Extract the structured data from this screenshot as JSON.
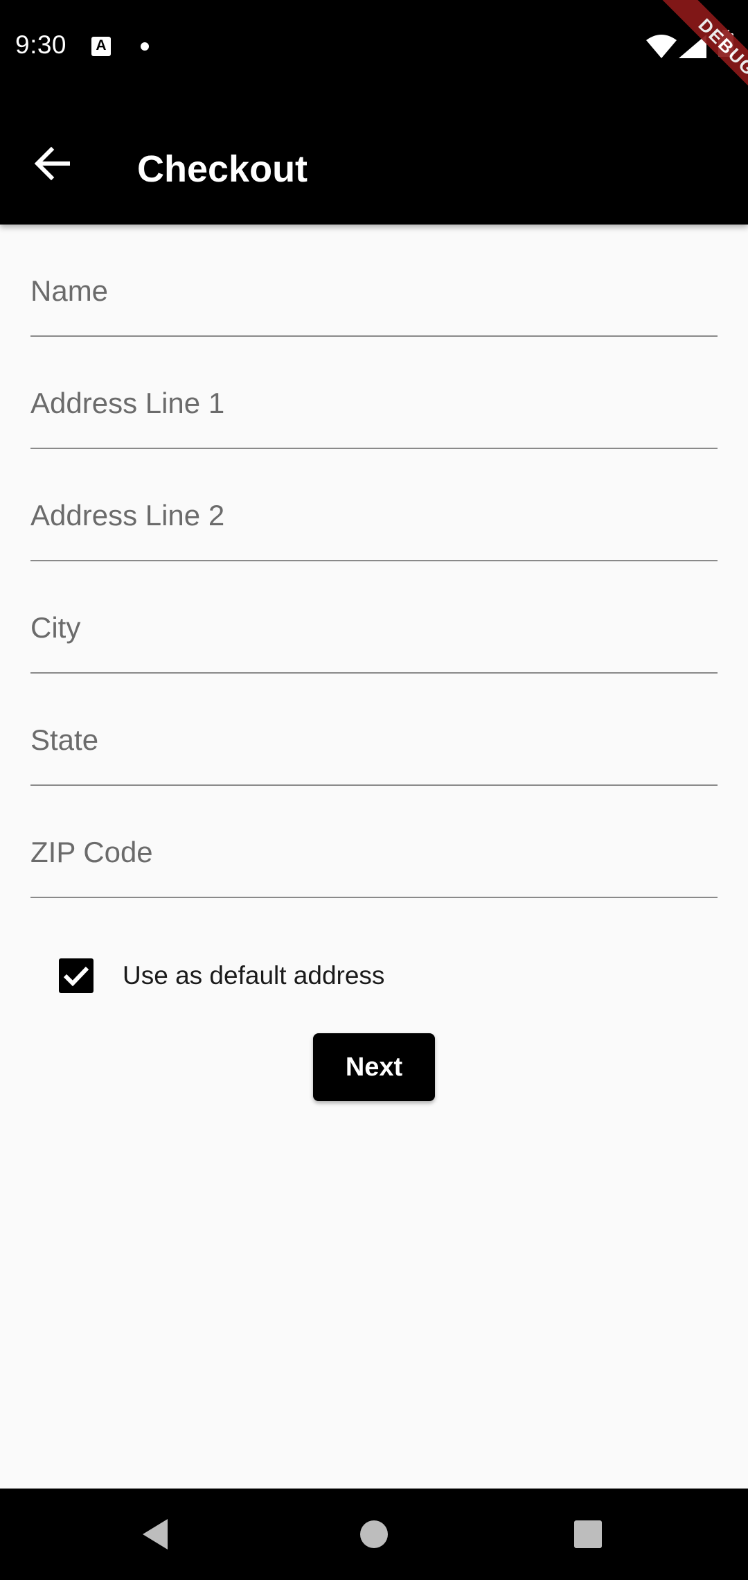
{
  "status_bar": {
    "time": "9:30",
    "notification_icon_letter": "A",
    "icons": [
      "a-notification-icon",
      "dot-icon",
      "wifi-icon",
      "signal-icon",
      "battery-icon"
    ]
  },
  "debug_banner": "DEBUG",
  "app_bar": {
    "title": "Checkout",
    "back_icon": "arrow-back-icon",
    "background_color": "#000000"
  },
  "form": {
    "fields": [
      {
        "placeholder": "Name",
        "value": ""
      },
      {
        "placeholder": "Address Line 1",
        "value": ""
      },
      {
        "placeholder": "Address Line 2",
        "value": ""
      },
      {
        "placeholder": "City",
        "value": ""
      },
      {
        "placeholder": "State",
        "value": ""
      },
      {
        "placeholder": "ZIP Code",
        "value": ""
      }
    ],
    "default_address_checkbox": {
      "label": "Use as default address",
      "checked": true
    },
    "next_button_label": "Next"
  },
  "navigation_bar": {
    "icons": [
      "nav-back-icon",
      "nav-home-icon",
      "nav-recents-icon"
    ]
  },
  "colors": {
    "background": "#fafafa",
    "primary": "#000000",
    "debug_ribbon": "#8b1a1a",
    "field_underline": "#8a8a8a",
    "placeholder": "#6b6b6b"
  }
}
